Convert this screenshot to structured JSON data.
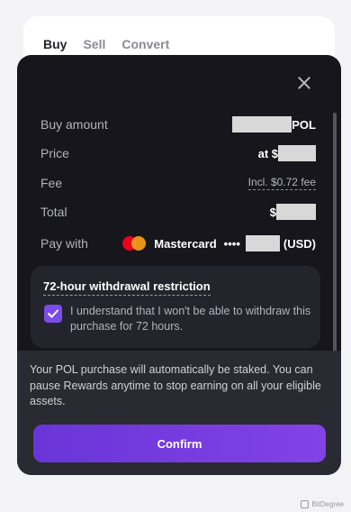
{
  "tabs": [
    {
      "label": "Buy",
      "active": true
    },
    {
      "label": "Sell",
      "active": false
    },
    {
      "label": "Convert",
      "active": false
    }
  ],
  "modal": {
    "rows": {
      "buy_amount": {
        "label": "Buy amount",
        "value": "POL"
      },
      "price": {
        "label": "Price",
        "value": "at $"
      },
      "fee": {
        "label": "Fee",
        "value": "Incl. $0.72 fee"
      },
      "total": {
        "label": "Total",
        "value": "$"
      },
      "pay_with": {
        "label": "Pay with",
        "card_name": "Mastercard",
        "card_mask": "••••",
        "currency": "(USD)"
      }
    },
    "restriction": {
      "title": "72-hour withdrawal restriction",
      "checked": true,
      "text": "I understand that I won't be able to withdraw this purchase for 72 hours."
    },
    "staking_notice": "Your POL purchase will automatically be staked. You can pause Rewards anytime to stop earning on all your eligible assets.",
    "confirm_label": "Confirm"
  },
  "watermark": "BitDegree",
  "colors": {
    "accent": "#7b4bea",
    "modal_bg": "#16161c",
    "mastercard_red": "#eb001b",
    "mastercard_orange": "#f79e1b"
  }
}
